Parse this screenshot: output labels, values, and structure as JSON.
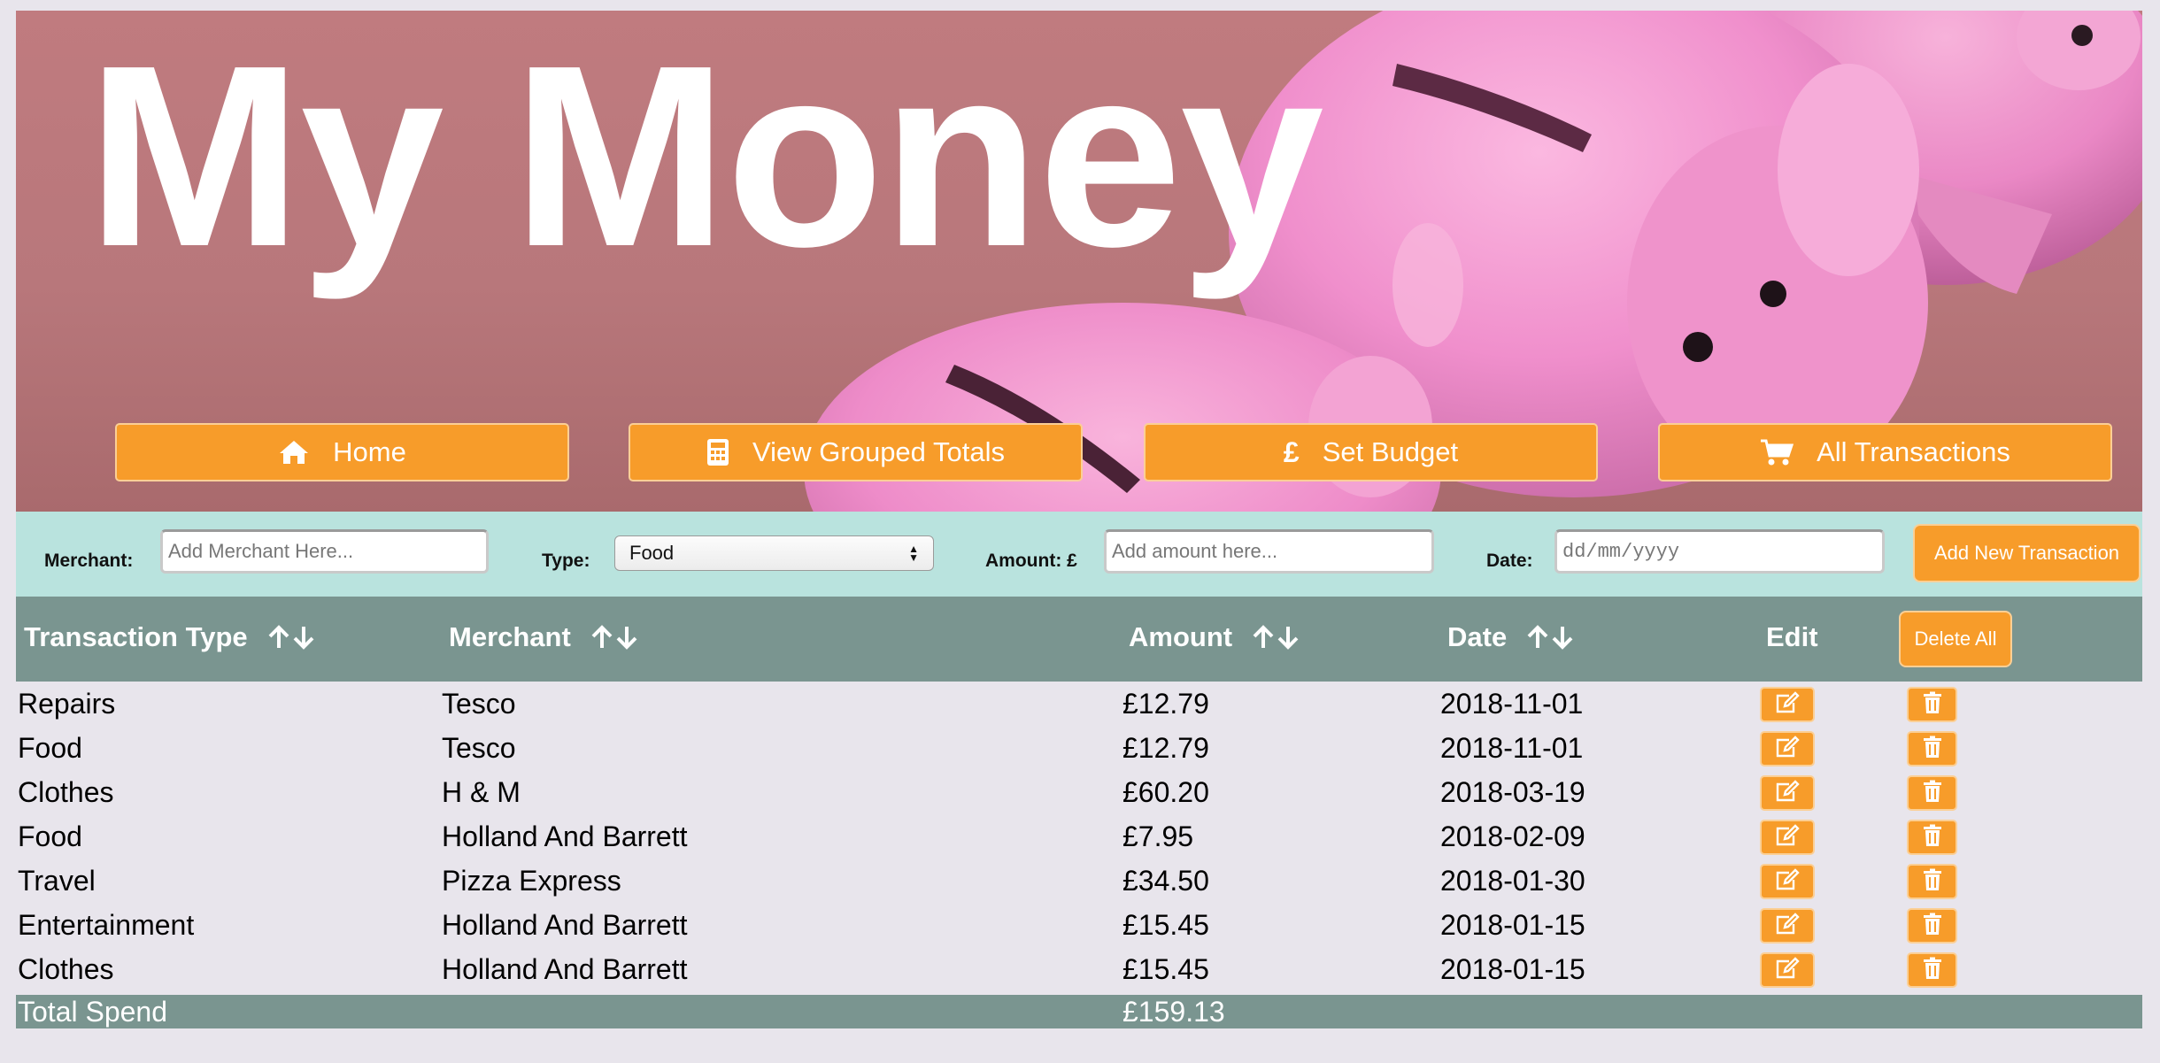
{
  "header": {
    "title": "My Money"
  },
  "nav": [
    {
      "label": "Home",
      "icon": "home-icon"
    },
    {
      "label": "View Grouped Totals",
      "icon": "calculator-icon"
    },
    {
      "label": "Set Budget",
      "icon": "pound-icon"
    },
    {
      "label": "All Transactions",
      "icon": "cart-icon"
    }
  ],
  "form": {
    "merchant_label": "Merchant:",
    "merchant_placeholder": "Add Merchant Here...",
    "type_label": "Type:",
    "type_selected": "Food",
    "amount_label": "Amount: £",
    "amount_placeholder": "Add amount here...",
    "date_label": "Date:",
    "date_placeholder": "dd/mm/yyyy",
    "add_button": "Add New Transaction"
  },
  "table": {
    "columns": {
      "type": "Transaction Type",
      "merchant": "Merchant",
      "amount": "Amount",
      "date": "Date",
      "edit": "Edit"
    },
    "delete_all": "Delete All",
    "rows": [
      {
        "type": "Repairs",
        "merchant": "Tesco",
        "amount": "£12.79",
        "date": "2018-11-01"
      },
      {
        "type": "Food",
        "merchant": "Tesco",
        "amount": "£12.79",
        "date": "2018-11-01"
      },
      {
        "type": "Clothes",
        "merchant": "H & M",
        "amount": "£60.20",
        "date": "2018-03-19"
      },
      {
        "type": "Food",
        "merchant": "Holland And Barrett",
        "amount": "£7.95",
        "date": "2018-02-09"
      },
      {
        "type": "Travel",
        "merchant": "Pizza Express",
        "amount": "£34.50",
        "date": "2018-01-30"
      },
      {
        "type": "Entertainment",
        "merchant": "Holland And Barrett",
        "amount": "£15.45",
        "date": "2018-01-15"
      },
      {
        "type": "Clothes",
        "merchant": "Holland And Barrett",
        "amount": "£15.45",
        "date": "2018-01-15"
      }
    ],
    "total_label": "Total Spend",
    "total_value": "£159.13"
  },
  "colors": {
    "accent": "#f79c2a",
    "header_bg": "#c07b7f",
    "form_bg": "#b9e3de",
    "table_header_bg": "#7a9590",
    "page_bg": "#e8e5ec"
  }
}
